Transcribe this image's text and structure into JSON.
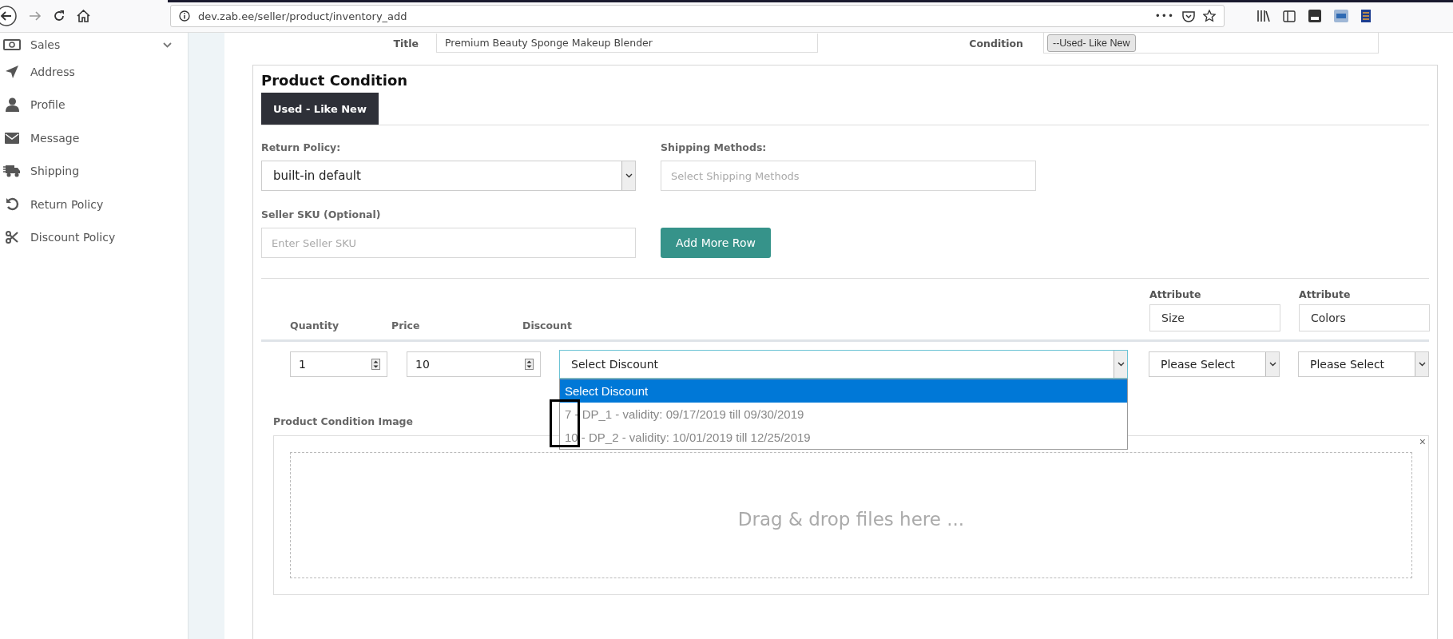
{
  "browser": {
    "url": "dev.zab.ee/seller/product/inventory_add",
    "menu_dots": "•••"
  },
  "sidebar": {
    "items": [
      {
        "label": "Sales",
        "expandable": true
      },
      {
        "label": "Address",
        "expandable": false
      },
      {
        "label": "Profile",
        "expandable": false
      },
      {
        "label": "Message",
        "expandable": false
      },
      {
        "label": "Shipping",
        "expandable": false
      },
      {
        "label": "Return Policy",
        "expandable": false
      },
      {
        "label": "Discount Policy",
        "expandable": false
      }
    ]
  },
  "product_header": {
    "title_label": "Title",
    "title_value": "Premium Beauty Sponge Makeup Blender",
    "condition_label": "Condition",
    "condition_value": "--Used- Like New"
  },
  "product_condition": {
    "heading": "Product Condition",
    "tabs": [
      {
        "label": "Used - Like New",
        "selected": true
      }
    ],
    "return_policy": {
      "label": "Return Policy:",
      "value": "built-in default"
    },
    "shipping_methods": {
      "label": "Shipping Methods:",
      "placeholder": "Select Shipping Methods"
    },
    "seller_sku": {
      "label": "Seller SKU (Optional)",
      "placeholder": "Enter Seller SKU"
    },
    "add_row_button": "Add More Row",
    "attributes": [
      {
        "label": "Attribute",
        "value": "Size"
      },
      {
        "label": "Attribute",
        "value": "Colors"
      }
    ],
    "columns": [
      "Quantity",
      "Price",
      "Discount"
    ],
    "row": {
      "quantity": "1",
      "price": "10",
      "discount": "Select Discount",
      "attribute_values": [
        "Please Select",
        "Please Select"
      ]
    },
    "discount_dropdown": {
      "open": true,
      "annotation_box": true,
      "options": [
        {
          "label": "Select Discount",
          "selected": true
        },
        {
          "label": "7 - DP_1 - validity: 09/17/2019 till 09/30/2019",
          "selected": false
        },
        {
          "label": "10 - DP_2 - validity: 10/01/2019 till 12/25/2019",
          "selected": false
        }
      ]
    },
    "image_label": "Product Condition Image",
    "dropzone": {
      "text": "Drag & drop files here ...",
      "close": "×"
    }
  }
}
